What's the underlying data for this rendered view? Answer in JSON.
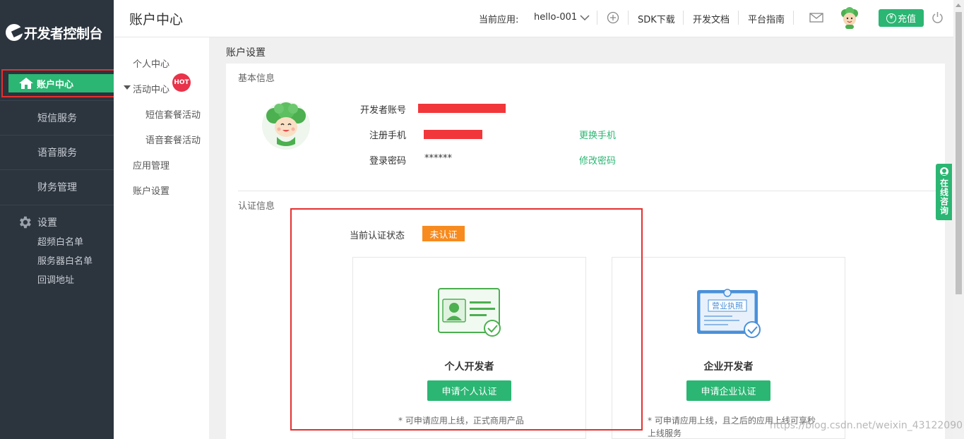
{
  "sidebar": {
    "logo": "开发者控制台",
    "active_item": "账户中心",
    "items": [
      "短信服务",
      "语音服务",
      "财务管理"
    ],
    "settings": {
      "label": "设置",
      "links": [
        "超频白名单",
        "服务器白名单",
        "回调地址"
      ]
    }
  },
  "header": {
    "title": "账户中心",
    "current_app_label": "当前应用:",
    "current_app": "hello-001",
    "links": [
      "SDK下载",
      "开发文档",
      "平台指南"
    ],
    "recharge": "充值",
    "yen": "¥"
  },
  "submenu": {
    "items": [
      "个人中心",
      "活动中心",
      "短信套餐活动",
      "语音套餐活动",
      "应用管理",
      "账户设置"
    ],
    "hot": "HOT"
  },
  "main": {
    "title": "账户设置",
    "basic": {
      "section": "基本信息",
      "account_label": "开发者账号",
      "phone_label": "注册手机",
      "phone_action": "更换手机",
      "password_label": "登录密码",
      "password_value": "******",
      "password_action": "修改密码"
    },
    "auth": {
      "section": "认证信息",
      "status_label": "当前认证状态",
      "status_value": "未认证",
      "cards": [
        {
          "title": "个人开发者",
          "button": "申请个人认证",
          "note": "* 可申请应用上线，正式商用产品"
        },
        {
          "title": "企业开发者",
          "button": "申请企业认证",
          "note_line1": "* 可申请应用上线，且之后的应用上线可享秒",
          "note_line2": "上线服务",
          "license_text": "营业执照"
        }
      ]
    }
  },
  "consult": "在线咨询",
  "watermark": "https://blog.csdn.net/weixin_43122090",
  "colors": {
    "accent": "#2bb673",
    "sidebar": "#2c343e",
    "warning": "#f78b1f",
    "highlight": "#e5302f"
  }
}
